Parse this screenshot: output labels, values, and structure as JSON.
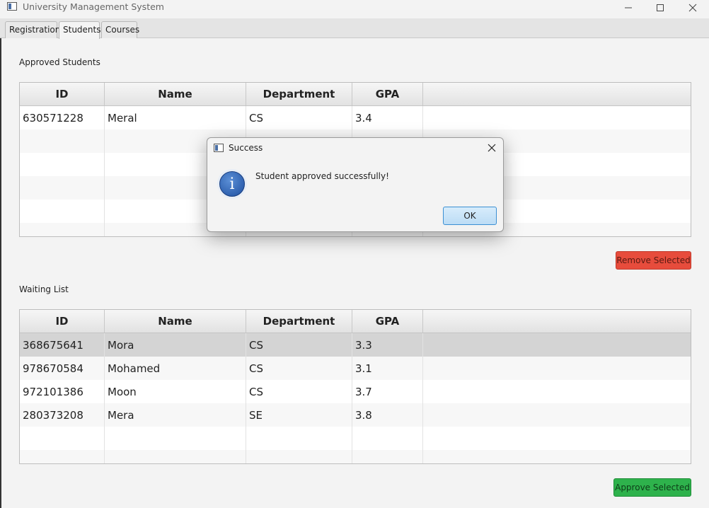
{
  "window": {
    "title": "University Management System",
    "controls": {
      "minimize": "–",
      "maximize": "☐",
      "close": "✕"
    }
  },
  "tabs": [
    {
      "label": "Registration",
      "selected": false
    },
    {
      "label": "Students",
      "selected": true
    },
    {
      "label": "Courses",
      "selected": false
    }
  ],
  "approved": {
    "label": "Approved Students",
    "columns": [
      "ID",
      "Name",
      "Department",
      "GPA"
    ],
    "rows": [
      {
        "id": "630571228",
        "name": "Meral",
        "department": "CS",
        "gpa": "3.4"
      }
    ],
    "remove_button": "Remove Selected"
  },
  "waiting": {
    "label": "Waiting List",
    "columns": [
      "ID",
      "Name",
      "Department",
      "GPA"
    ],
    "rows": [
      {
        "id": "368675641",
        "name": "Mora",
        "department": "CS",
        "gpa": "3.3"
      },
      {
        "id": "978670584",
        "name": "Mohamed",
        "department": "CS",
        "gpa": "3.1"
      },
      {
        "id": "972101386",
        "name": "Moon",
        "department": "CS",
        "gpa": "3.7"
      },
      {
        "id": "280373208",
        "name": "Mera",
        "department": "SE",
        "gpa": "3.8"
      }
    ],
    "approve_button": "Approve Selected"
  },
  "dialog": {
    "title": "Success",
    "message": "Student approved successfully!",
    "ok_label": "OK",
    "icon": "info-icon",
    "icon_glyph": "i",
    "close_glyph": "✕"
  },
  "colors": {
    "remove_button": "#e74c3c",
    "approve_button": "#2eb24c",
    "info_icon": "#1e4fa0"
  }
}
